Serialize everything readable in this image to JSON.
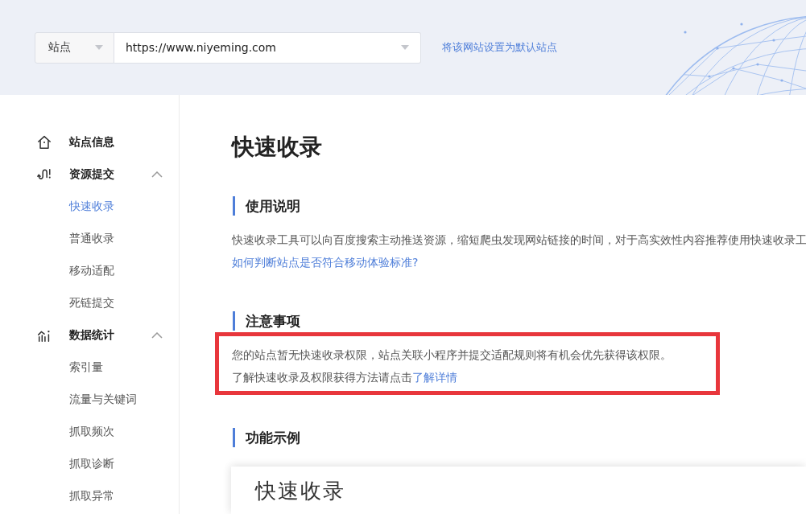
{
  "site_selector": {
    "type_label": "站点",
    "url": "https://www.niyeming.com"
  },
  "default_site_link": "将该网站设置为默认站点",
  "sidebar": {
    "items": [
      {
        "kind": "link",
        "label": "站点信息",
        "selected": false
      },
      {
        "kind": "group",
        "label": "资源提交",
        "selected": false,
        "expanded": true,
        "children": [
          {
            "label": "快速收录",
            "selected": true
          },
          {
            "label": "普通收录",
            "selected": false
          },
          {
            "label": "移动适配",
            "selected": false
          },
          {
            "label": "死链提交",
            "selected": false
          }
        ]
      },
      {
        "kind": "group",
        "label": "数据统计",
        "selected": false,
        "expanded": true,
        "children": [
          {
            "label": "索引量",
            "selected": false
          },
          {
            "label": "流量与关键词",
            "selected": false
          },
          {
            "label": "抓取频次",
            "selected": false
          },
          {
            "label": "抓取诊断",
            "selected": false
          },
          {
            "label": "抓取异常",
            "selected": false
          }
        ]
      }
    ]
  },
  "page_title": "快速收录",
  "sections": [
    {
      "kind": "text",
      "heading": "使用说明",
      "paragraph": "快速收录工具可以向百度搜索主动推送资源，缩短爬虫发现网站链接的时间，对于高实效性内容推荐使用快速收录工",
      "link": "如何判断站点是否符合移动体验标准?"
    },
    {
      "kind": "notice",
      "heading": "注意事项",
      "highlighted": true,
      "lines": [
        {
          "text": "您的站点暂无快速收录权限，站点关联小程序并提交适配规则将有机会优先获得该权限。"
        },
        {
          "text": "了解快速收录及权限获得方法请点击",
          "link": "了解详情"
        }
      ]
    },
    {
      "kind": "example",
      "heading": "功能示例",
      "preview_title": "快速收录"
    }
  ]
}
